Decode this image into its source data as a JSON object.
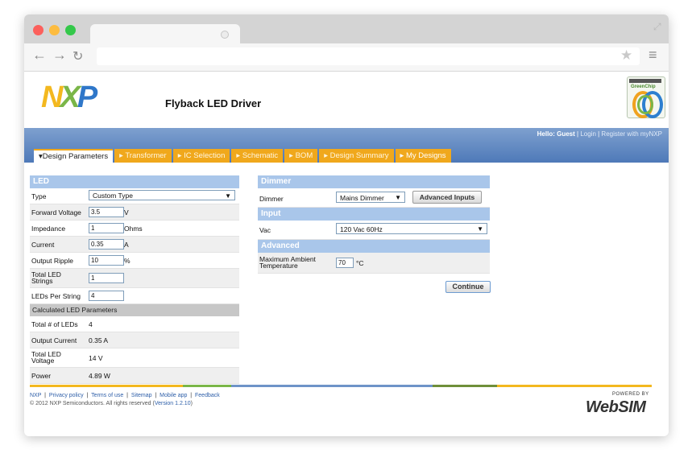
{
  "browser": {
    "dot_colors": [
      "#fc605c",
      "#fdbc40",
      "#34c84a"
    ],
    "nav_icons": [
      "back-arrow-icon",
      "forward-arrow-icon",
      "reload-icon"
    ],
    "star_icon": "star-icon",
    "menu_icon": "hamburger-menu-icon"
  },
  "header": {
    "logo_n": "N",
    "logo_x": "X",
    "logo_p": "P",
    "title": "Flyback LED Driver",
    "badge_text": "GreenChip"
  },
  "account": {
    "hello": "Hello: Guest",
    "login": "Login",
    "register": "Register with myNXP"
  },
  "tabs": [
    {
      "label": "Design Parameters",
      "active": true
    },
    {
      "label": "Transformer"
    },
    {
      "label": "IC Selection"
    },
    {
      "label": "Schematic"
    },
    {
      "label": "BOM"
    },
    {
      "label": "Design Summary"
    },
    {
      "label": "My Designs"
    }
  ],
  "led": {
    "heading": "LED",
    "type_label": "Type",
    "type_value": "Custom Type",
    "forward_voltage_label": "Forward Voltage",
    "forward_voltage_value": "3.5",
    "forward_voltage_unit": "V",
    "impedance_label": "Impedance",
    "impedance_value": "1",
    "impedance_unit": "Ohms",
    "current_label": "Current",
    "current_value": "0.35",
    "current_unit": "A",
    "ripple_label": "Output Ripple",
    "ripple_value": "10",
    "ripple_unit": "%",
    "strings_label_1": "Total LED",
    "strings_label_2": "Strings",
    "strings_value": "1",
    "per_string_label": "LEDs Per String",
    "per_string_value": "4"
  },
  "calculated": {
    "heading": "Calculated LED Parameters",
    "total_leds_label": "Total # of LEDs",
    "total_leds_value": "4",
    "output_current_label": "Output Current",
    "output_current_value": "0.35 A",
    "voltage_label_1": "Total LED",
    "voltage_label_2": "Voltage",
    "voltage_value": "14 V",
    "power_label": "Power",
    "power_value": "4.89 W"
  },
  "dimmer": {
    "heading": "Dimmer",
    "label": "Dimmer",
    "value": "Mains Dimmer",
    "advanced_button": "Advanced Inputs"
  },
  "input": {
    "heading": "Input",
    "vac_label": "Vac",
    "vac_value": "120 Vac 60Hz"
  },
  "advanced": {
    "heading": "Advanced",
    "temp_label_1": "Maximum Ambient",
    "temp_label_2": "Temperature",
    "temp_value": "70",
    "temp_unit": "°C"
  },
  "continue_label": "Continue",
  "footer": {
    "links": [
      "NXP",
      "Privacy policy",
      "Terms of use",
      "Sitemap",
      "Mobile app",
      "Feedback"
    ],
    "copyright": "© 2012 NXP Semiconductors. All rights reserved",
    "version": "Version 1.2.10",
    "powered_by": "POWERED BY",
    "websim": "WebSIM",
    "line_colors": [
      "#f3b81f",
      "#7ab648",
      "#4e79b8",
      "#7ab648",
      "#f3b81f"
    ]
  }
}
